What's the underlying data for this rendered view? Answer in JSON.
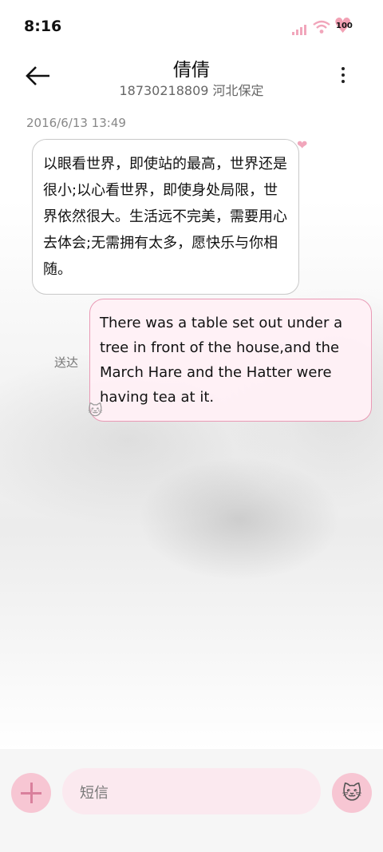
{
  "status_bar": {
    "time": "8:16",
    "battery_level": "100"
  },
  "header": {
    "contact_name": "倩倩",
    "contact_info": "18730218809 河北保定"
  },
  "messages": [
    {
      "timestamp": "2016/6/13 13:49",
      "direction": "incoming",
      "text": "以眼看世界，即使站的最高，世界还是很小;以心看世界，即使身处局限，世界依然很大。生活远不完美，需要用心去体会;无需拥有太多，愿快乐与你相随。"
    },
    {
      "direction": "outgoing",
      "status": "送达",
      "text": "There was a table set out under a tree in front of the house,and the March Hare and the Hatter were having tea at it."
    }
  ],
  "composer": {
    "placeholder": "短信"
  },
  "colors": {
    "accent_pink": "#f7c6d3",
    "outgoing_border": "#e99ab5"
  }
}
